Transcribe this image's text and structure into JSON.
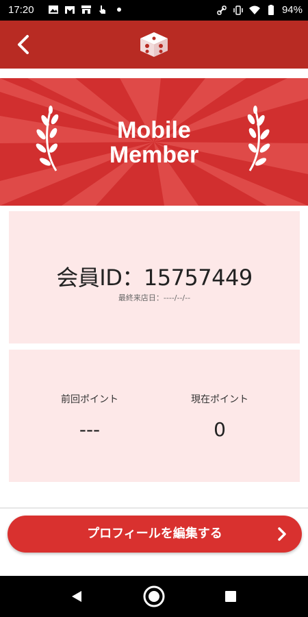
{
  "status_bar": {
    "time": "17:20",
    "battery": "94%",
    "left_icons": [
      "image-icon",
      "gmail-icon",
      "store-icon",
      "hand-icon",
      "dot-icon"
    ],
    "right_icons": [
      "link-icon",
      "vibrate-icon",
      "wifi-icon",
      "battery-icon"
    ]
  },
  "header": {
    "back_icon": "chevron-left-icon",
    "logo_icon": "dice-logo-icon",
    "background": "#b82b23"
  },
  "banner": {
    "title_line1": "Mobile",
    "title_line2": "Member",
    "background": "#d12f2f"
  },
  "member_card": {
    "member_id": "会員ID：15757449",
    "last_visit": "最終来店日：----/--/--"
  },
  "points_card": {
    "previous_label": "前回ポイント",
    "previous_value": "---",
    "current_label": "現在ポイント",
    "current_value": "0"
  },
  "edit_button": {
    "label": "プロフィールを編集する",
    "background": "#d9312f"
  },
  "nav_bar": {
    "icons": [
      "nav-back-icon",
      "nav-home-icon",
      "nav-recent-icon"
    ]
  }
}
